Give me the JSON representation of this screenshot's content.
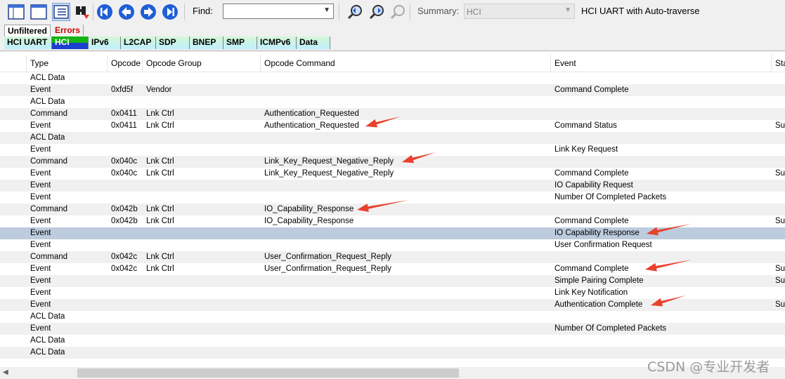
{
  "toolbar": {
    "find_label": "Find:",
    "find_value": "",
    "summary_label": "Summary:",
    "summary_value": "HCI",
    "summary_text": "HCI UART with Auto-traverse"
  },
  "tabs_top": [
    {
      "label": "Unfiltered"
    },
    {
      "label": "Errors"
    }
  ],
  "tabs_protocol": [
    {
      "label": "HCI UART"
    },
    {
      "label": "HCI"
    },
    {
      "label": "IPv6"
    },
    {
      "label": "L2CAP"
    },
    {
      "label": "SDP"
    },
    {
      "label": "BNEP"
    },
    {
      "label": "SMP"
    },
    {
      "label": "ICMPv6"
    },
    {
      "label": "Data"
    }
  ],
  "columns": {
    "type": "Type",
    "opcode": "Opcode",
    "opcode_group": "Opcode Group",
    "opcode_command": "Opcode Command",
    "event": "Event",
    "status": "Sta"
  },
  "rows": [
    {
      "type": "ACL Data",
      "opcode": "",
      "group": "",
      "command": "",
      "event": "",
      "status": ""
    },
    {
      "type": "Event",
      "opcode": "0xfd5f",
      "group": "Vendor",
      "command": "",
      "event": "Command Complete",
      "status": ""
    },
    {
      "type": "ACL Data",
      "opcode": "",
      "group": "",
      "command": "",
      "event": "",
      "status": ""
    },
    {
      "type": "Command",
      "opcode": "0x0411",
      "group": "Lnk Ctrl",
      "command": "Authentication_Requested",
      "event": "",
      "status": ""
    },
    {
      "type": "Event",
      "opcode": "0x0411",
      "group": "Lnk Ctrl",
      "command": "Authentication_Requested",
      "event": "Command Status",
      "status": "Su"
    },
    {
      "type": "ACL Data",
      "opcode": "",
      "group": "",
      "command": "",
      "event": "",
      "status": ""
    },
    {
      "type": "Event",
      "opcode": "",
      "group": "",
      "command": "",
      "event": "Link Key Request",
      "status": ""
    },
    {
      "type": "Command",
      "opcode": "0x040c",
      "group": "Lnk Ctrl",
      "command": "Link_Key_Request_Negative_Reply",
      "event": "",
      "status": ""
    },
    {
      "type": "Event",
      "opcode": "0x040c",
      "group": "Lnk Ctrl",
      "command": "Link_Key_Request_Negative_Reply",
      "event": "Command Complete",
      "status": "Su"
    },
    {
      "type": "Event",
      "opcode": "",
      "group": "",
      "command": "",
      "event": "IO Capability Request",
      "status": ""
    },
    {
      "type": "Event",
      "opcode": "",
      "group": "",
      "command": "",
      "event": "Number Of Completed Packets",
      "status": ""
    },
    {
      "type": "Command",
      "opcode": "0x042b",
      "group": "Lnk Ctrl",
      "command": "IO_Capability_Response",
      "event": "",
      "status": ""
    },
    {
      "type": "Event",
      "opcode": "0x042b",
      "group": "Lnk Ctrl",
      "command": "IO_Capability_Response",
      "event": "Command Complete",
      "status": "Su"
    },
    {
      "type": "Event",
      "opcode": "",
      "group": "",
      "command": "",
      "event": "IO Capability Response",
      "status": "",
      "selected": true
    },
    {
      "type": "Event",
      "opcode": "",
      "group": "",
      "command": "",
      "event": "User Confirmation Request",
      "status": ""
    },
    {
      "type": "Command",
      "opcode": "0x042c",
      "group": "Lnk Ctrl",
      "command": "User_Confirmation_Request_Reply",
      "event": "",
      "status": ""
    },
    {
      "type": "Event",
      "opcode": "0x042c",
      "group": "Lnk Ctrl",
      "command": "User_Confirmation_Request_Reply",
      "event": "Command Complete",
      "status": "Su"
    },
    {
      "type": "Event",
      "opcode": "",
      "group": "",
      "command": "",
      "event": "Simple Pairing Complete",
      "status": "Su"
    },
    {
      "type": "Event",
      "opcode": "",
      "group": "",
      "command": "",
      "event": "Link Key Notification",
      "status": ""
    },
    {
      "type": "Event",
      "opcode": "",
      "group": "",
      "command": "",
      "event": "Authentication Complete",
      "status": "Su"
    },
    {
      "type": "ACL Data",
      "opcode": "",
      "group": "",
      "command": "",
      "event": "",
      "status": ""
    },
    {
      "type": "Event",
      "opcode": "",
      "group": "",
      "command": "",
      "event": "Number Of Completed Packets",
      "status": ""
    },
    {
      "type": "ACL Data",
      "opcode": "",
      "group": "",
      "command": "",
      "event": "",
      "status": ""
    },
    {
      "type": "ACL Data",
      "opcode": "",
      "group": "",
      "command": "",
      "event": "",
      "status": ""
    }
  ],
  "annotation": {
    "arrow_color": "#e8412c",
    "arrow_rows": [
      4,
      7,
      11,
      13,
      16,
      19
    ]
  },
  "watermark": "CSDN @专业开发者"
}
